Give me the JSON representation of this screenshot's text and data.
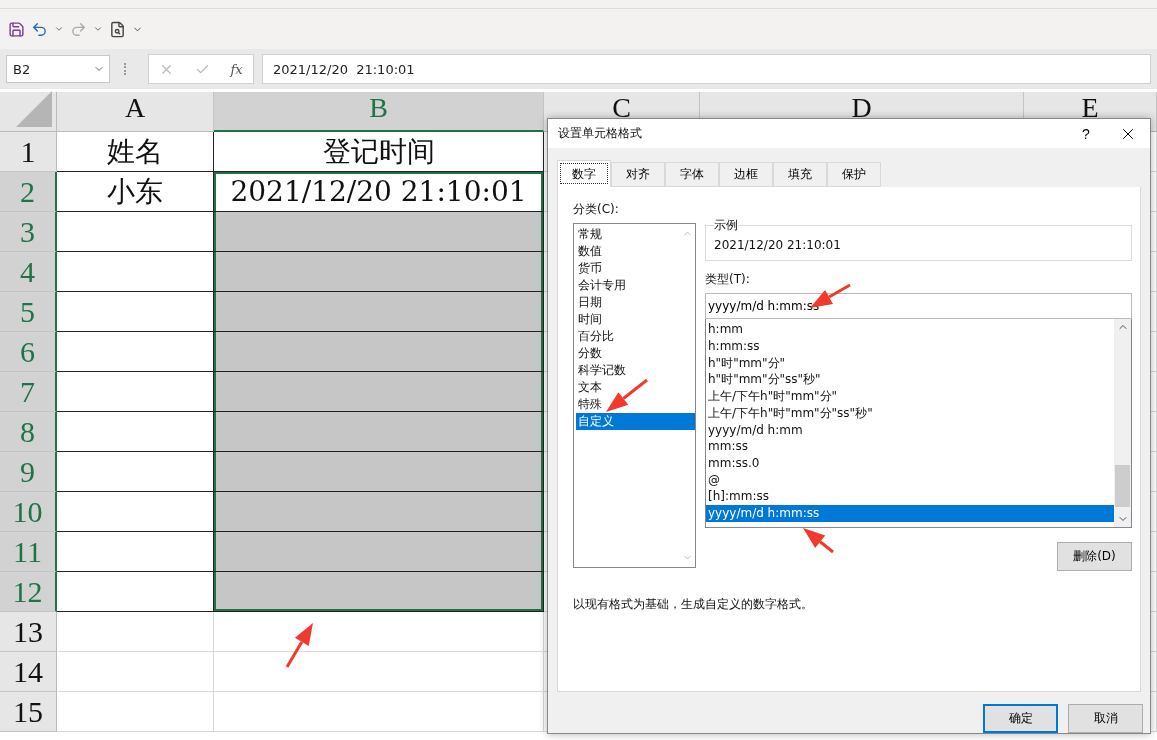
{
  "toolbar": {
    "items": [
      {
        "kind": "save"
      },
      {
        "kind": "undo"
      },
      {
        "kind": "caret"
      },
      {
        "kind": "redo"
      },
      {
        "kind": "caret"
      },
      {
        "kind": "preview"
      },
      {
        "kind": "more"
      }
    ]
  },
  "formula_bar": {
    "name_box": "B2",
    "function_button": "fx",
    "formula": "2021/12/20  21:10:01"
  },
  "sheet": {
    "columns": [
      {
        "label": "A",
        "selected": false
      },
      {
        "label": "B",
        "selected": true
      },
      {
        "label": "C",
        "selected": false
      },
      {
        "label": "D",
        "selected": false
      },
      {
        "label": "E",
        "selected": false
      }
    ],
    "rows": [
      {
        "header": "1",
        "selected": false,
        "cells": [
          {
            "text": "姓名",
            "shaded": false
          },
          {
            "text": "登记时间",
            "shaded": false
          }
        ]
      },
      {
        "header": "2",
        "selected": true,
        "cells": [
          {
            "text": "小东",
            "shaded": false
          },
          {
            "text": "2021/12/20 21:10:01",
            "shaded": false
          }
        ]
      },
      {
        "header": "3",
        "selected": true,
        "cells": [
          {
            "shaded": false
          },
          {
            "shaded": true
          }
        ]
      },
      {
        "header": "4",
        "selected": true,
        "cells": [
          {
            "shaded": false
          },
          {
            "shaded": true
          }
        ]
      },
      {
        "header": "5",
        "selected": true,
        "cells": [
          {
            "shaded": false
          },
          {
            "shaded": true
          }
        ]
      },
      {
        "header": "6",
        "selected": true,
        "cells": [
          {
            "shaded": false
          },
          {
            "shaded": true
          }
        ]
      },
      {
        "header": "7",
        "selected": true,
        "cells": [
          {
            "shaded": false
          },
          {
            "shaded": true
          }
        ]
      },
      {
        "header": "8",
        "selected": true,
        "cells": [
          {
            "shaded": false
          },
          {
            "shaded": true
          }
        ]
      },
      {
        "header": "9",
        "selected": true,
        "cells": [
          {
            "shaded": false
          },
          {
            "shaded": true
          }
        ]
      },
      {
        "header": "10",
        "selected": true,
        "cells": [
          {
            "shaded": false
          },
          {
            "shaded": true
          }
        ]
      },
      {
        "header": "11",
        "selected": true,
        "cells": [
          {
            "shaded": false
          },
          {
            "shaded": true
          }
        ]
      },
      {
        "header": "12",
        "selected": true,
        "cells": [
          {
            "shaded": false
          },
          {
            "shaded": true
          }
        ]
      },
      {
        "header": "13",
        "selected": false,
        "cells": [
          {
            "shaded": false
          },
          {
            "shaded": false
          }
        ]
      },
      {
        "header": "14",
        "selected": false,
        "cells": [
          {
            "shaded": false
          },
          {
            "shaded": false
          }
        ]
      },
      {
        "header": "15",
        "selected": false,
        "cells": [
          {
            "shaded": false
          },
          {
            "shaded": false
          }
        ]
      }
    ]
  },
  "dialog": {
    "title": "设置单元格格式",
    "help": "?",
    "tabs": [
      {
        "label": "数字",
        "selected": true
      },
      {
        "label": "对齐",
        "selected": false
      },
      {
        "label": "字体",
        "selected": false
      },
      {
        "label": "边框",
        "selected": false
      },
      {
        "label": "填充",
        "selected": false
      },
      {
        "label": "保护",
        "selected": false
      }
    ],
    "category_label": "分类(C):",
    "categories": [
      {
        "label": "常规",
        "selected": false
      },
      {
        "label": "数值",
        "selected": false
      },
      {
        "label": "货币",
        "selected": false
      },
      {
        "label": "会计专用",
        "selected": false
      },
      {
        "label": "日期",
        "selected": false
      },
      {
        "label": "时间",
        "selected": false
      },
      {
        "label": "百分比",
        "selected": false
      },
      {
        "label": "分数",
        "selected": false
      },
      {
        "label": "科学记数",
        "selected": false
      },
      {
        "label": "文本",
        "selected": false
      },
      {
        "label": "特殊",
        "selected": false
      },
      {
        "label": "自定义",
        "selected": true
      }
    ],
    "sample_label": "示例",
    "sample_value": "2021/12/20 21:10:01",
    "type_label": "类型(T):",
    "type_value": "yyyy/m/d h:mm:ss",
    "types": [
      {
        "label": "h:mm",
        "selected": false
      },
      {
        "label": "h:mm:ss",
        "selected": false
      },
      {
        "label": "h\"时\"mm\"分\"",
        "selected": false
      },
      {
        "label": "h\"时\"mm\"分\"ss\"秒\"",
        "selected": false
      },
      {
        "label": "上午/下午h\"时\"mm\"分\"",
        "selected": false
      },
      {
        "label": "上午/下午h\"时\"mm\"分\"ss\"秒\"",
        "selected": false
      },
      {
        "label": "yyyy/m/d h:mm",
        "selected": false
      },
      {
        "label": "mm:ss",
        "selected": false
      },
      {
        "label": "mm:ss.0",
        "selected": false
      },
      {
        "label": "@",
        "selected": false
      },
      {
        "label": "[h]:mm:ss",
        "selected": false
      },
      {
        "label": "yyyy/m/d h:mm:ss",
        "selected": true
      }
    ],
    "delete_button": "删除(D)",
    "description": "以现有格式为基础，生成自定义的数字格式。",
    "buttons": [
      {
        "label": "确定",
        "default": true
      },
      {
        "label": "取消",
        "default": false
      }
    ]
  }
}
